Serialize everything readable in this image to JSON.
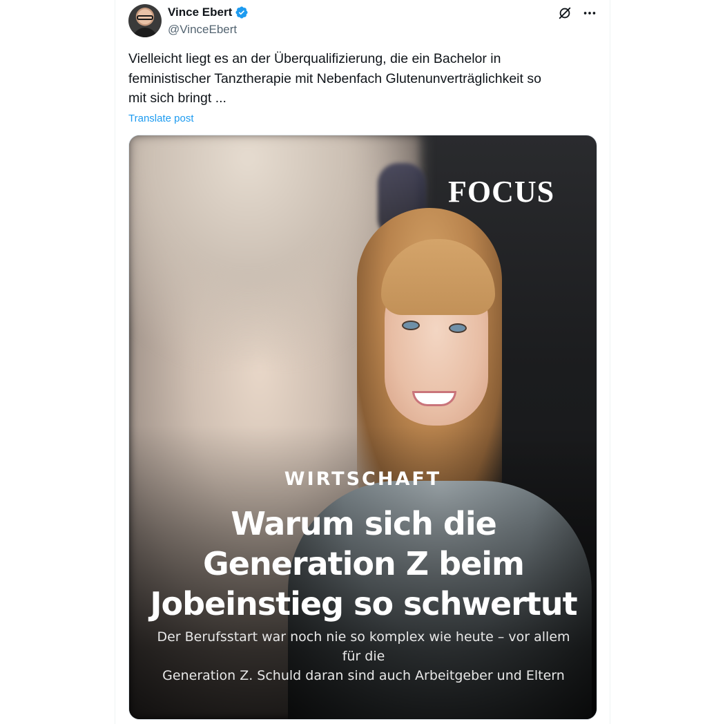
{
  "author": {
    "display_name": "Vince Ebert",
    "handle": "@VinceEbert",
    "verified": true,
    "verified_color": "#1d9bf0",
    "avatar_icon": "avatar-photo"
  },
  "actions": {
    "grok_icon": "slash-circle-icon",
    "more_icon": "more-horizontal-icon"
  },
  "post": {
    "text": "Vielleicht liegt es an der Überqualifizierung, die ein Bachelor in\nfeministischer Tanztherapie mit Nebenfach Glutenunverträglichkeit so\nmit sich bringt ...",
    "translate_label": "Translate post",
    "link_color": "#1d9bf0"
  },
  "media": {
    "brand": "FOCUS",
    "category": "WIRTSCHAFT",
    "headline": "Warum sich die\nGeneration Z beim\nJobeinstieg so schwertut",
    "subline": "Der Berufsstart war noch nie so komplex wie heute – vor allem für die\nGeneration Z. Schuld daran sind auch Arbeitgeber und Eltern"
  }
}
